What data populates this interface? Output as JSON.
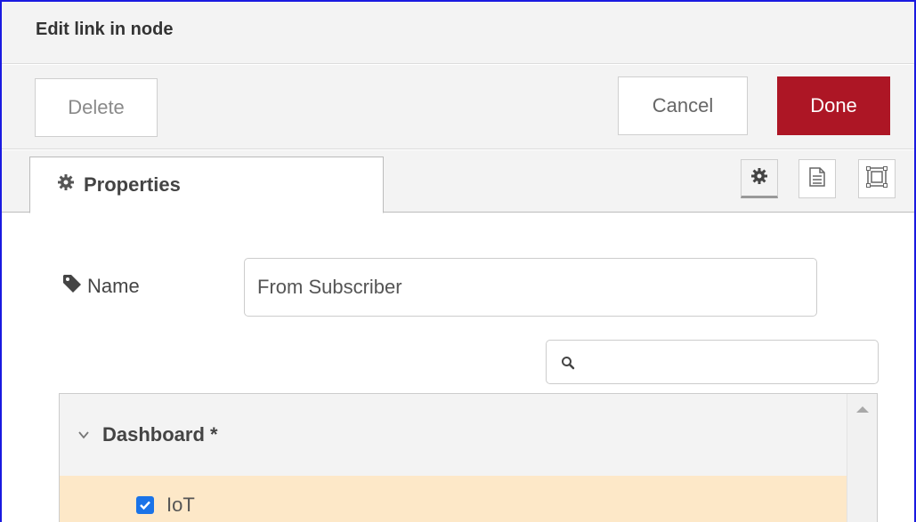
{
  "tray": {
    "title": "Edit link in node"
  },
  "toolbar": {
    "delete_label": "Delete",
    "cancel_label": "Cancel",
    "done_label": "Done"
  },
  "tabs": {
    "properties_label": "Properties",
    "buttons": [
      "gear-icon",
      "description-icon",
      "appearance-icon"
    ]
  },
  "form": {
    "name_label": "Name",
    "name_value": "From Subscriber",
    "search_placeholder": ""
  },
  "tree": {
    "group_label": "Dashboard *",
    "items": [
      {
        "label": "IoT",
        "checked": true
      }
    ]
  },
  "colors": {
    "done_button": "#ad1625",
    "selected_row": "#fde8c8",
    "checkbox": "#1a73e8",
    "window_border": "#1a1ae0"
  }
}
